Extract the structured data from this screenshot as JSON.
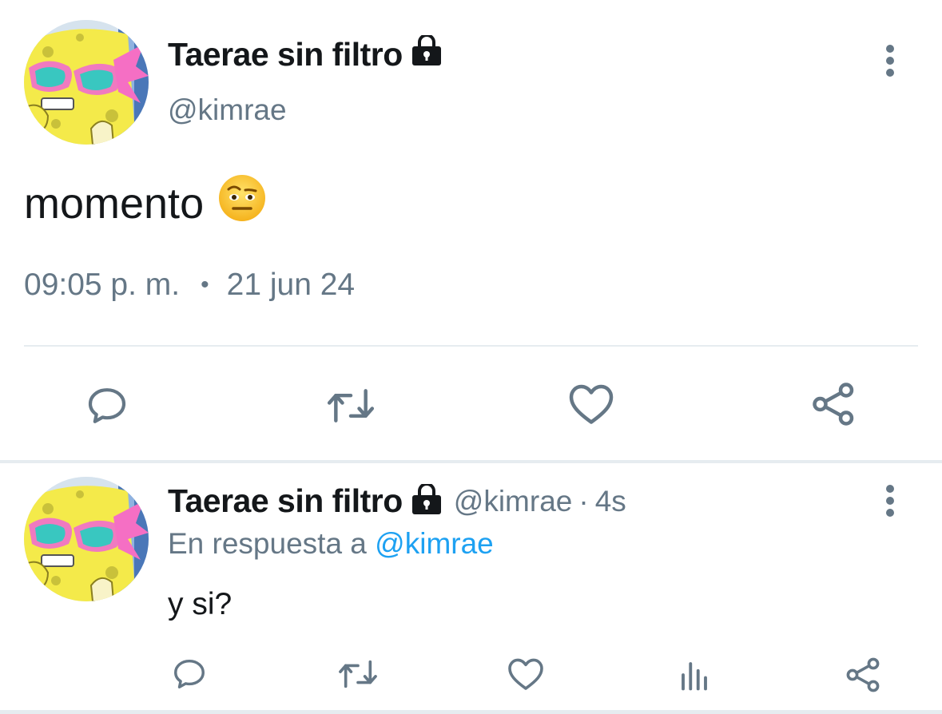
{
  "main_tweet": {
    "display_name": "Taerae sin filtro",
    "handle": "@kimrae",
    "text": "momento",
    "emoji_icon": "face-with-raised-eyebrow-emoji",
    "time": "09:05 p. m.",
    "separator": "•",
    "date": "21 jun 24",
    "actions": [
      "reply-icon",
      "retweet-icon",
      "like-icon",
      "share-icon"
    ]
  },
  "reply_tweet": {
    "display_name": "Taerae sin filtro",
    "handle": "@kimrae",
    "separator": "·",
    "relative_time": "4s",
    "reply_prefix": "En respuesta a ",
    "reply_target": "@kimrae",
    "text": "y si?",
    "actions": [
      "reply-icon",
      "retweet-icon",
      "like-icon",
      "analytics-icon",
      "share-icon"
    ]
  },
  "colors": {
    "text_primary": "#14171a",
    "text_secondary": "#657786",
    "link": "#1da1f2",
    "divider": "#e6ecf0"
  }
}
